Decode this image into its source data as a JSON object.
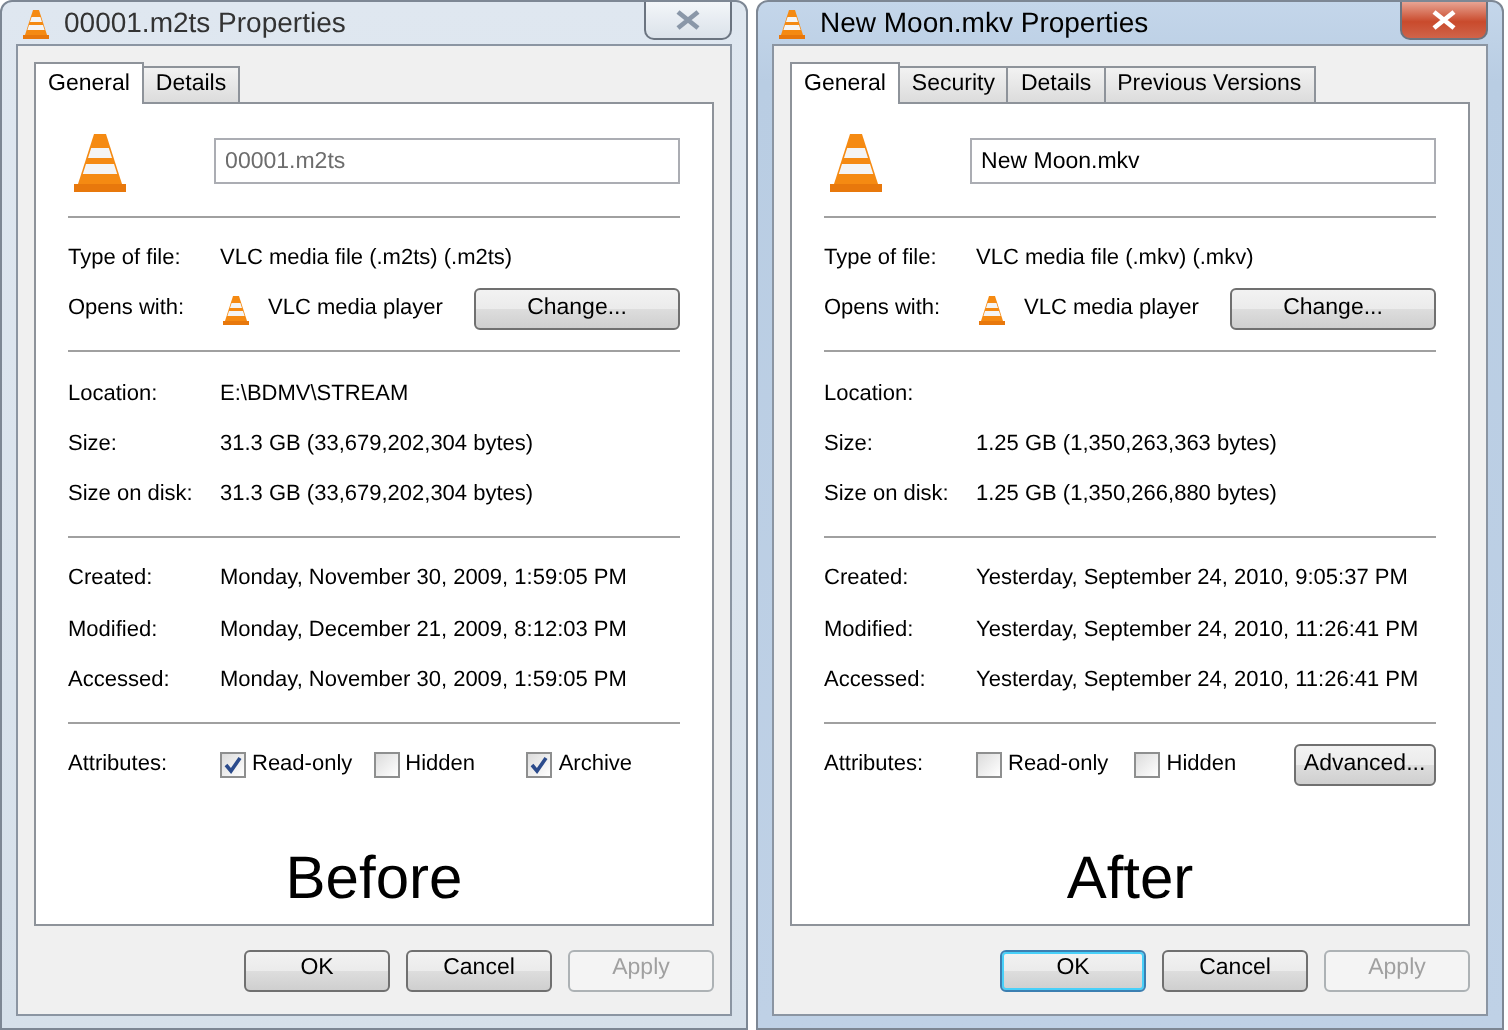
{
  "dialogs": [
    {
      "title": "00001.m2ts Properties",
      "active": false,
      "tabs": [
        {
          "label": "General",
          "selected": true
        },
        {
          "label": "Details",
          "selected": false
        }
      ],
      "file_name": {
        "value": "00001.m2ts",
        "disabled": true
      },
      "type_row": {
        "label": "Type of file:",
        "value": "VLC media file (.m2ts) (.m2ts)"
      },
      "opens_with": {
        "label": "Opens with:",
        "value": "VLC media player",
        "button": "Change..."
      },
      "sections": [
        [
          {
            "label": "Location:",
            "value": "E:\\BDMV\\STREAM"
          },
          {
            "label": "Size:",
            "value": "31.3 GB (33,679,202,304 bytes)"
          },
          {
            "label": "Size on disk:",
            "value": "31.3 GB (33,679,202,304 bytes)"
          }
        ],
        [
          {
            "label": "Created:",
            "value": "Monday, November 30, 2009, 1:59:05 PM"
          },
          {
            "label": "Modified:",
            "value": "Monday, December 21, 2009, 8:12:03 PM"
          },
          {
            "label": "Accessed:",
            "value": "Monday, November 30, 2009, 1:59:05 PM"
          }
        ]
      ],
      "attributes": {
        "label": "Attributes:",
        "checkboxes": [
          {
            "label": "Read-only",
            "checked": true
          },
          {
            "label": "Hidden",
            "checked": false
          },
          {
            "label": "Archive",
            "checked": true
          }
        ]
      },
      "caption": "Before",
      "buttons": [
        {
          "label": "OK",
          "default": false,
          "disabled": false
        },
        {
          "label": "Cancel",
          "default": false,
          "disabled": false
        },
        {
          "label": "Apply",
          "default": false,
          "disabled": true
        }
      ]
    },
    {
      "title": "New Moon.mkv Properties",
      "active": true,
      "tabs": [
        {
          "label": "General",
          "selected": true
        },
        {
          "label": "Security",
          "selected": false
        },
        {
          "label": "Details",
          "selected": false
        },
        {
          "label": "Previous Versions",
          "selected": false
        }
      ],
      "file_name": {
        "value": "New Moon.mkv",
        "disabled": false
      },
      "type_row": {
        "label": "Type of file:",
        "value": "VLC media file (.mkv) (.mkv)"
      },
      "opens_with": {
        "label": "Opens with:",
        "value": "VLC media player",
        "button": "Change..."
      },
      "sections": [
        [
          {
            "label": "Location:"
          },
          {
            "label": "Size:",
            "value": "1.25 GB (1,350,263,363 bytes)"
          },
          {
            "label": "Size on disk:",
            "value": "1.25 GB (1,350,266,880 bytes)"
          }
        ],
        [
          {
            "label": "Created:",
            "value": "Yesterday, September 24, 2010, 9:05:37 PM"
          },
          {
            "label": "Modified:",
            "value": "Yesterday, September 24, 2010, 11:26:41 PM"
          },
          {
            "label": "Accessed:",
            "value": "Yesterday, September 24, 2010, 11:26:41 PM"
          }
        ]
      ],
      "attributes": {
        "label": "Attributes:",
        "checkboxes": [
          {
            "label": "Read-only",
            "checked": false
          },
          {
            "label": "Hidden",
            "checked": false
          }
        ],
        "button": "Advanced..."
      },
      "caption": "After",
      "buttons": [
        {
          "label": "OK",
          "default": true,
          "disabled": false
        },
        {
          "label": "Cancel",
          "default": false,
          "disabled": false
        },
        {
          "label": "Apply",
          "default": false,
          "disabled": true
        }
      ]
    }
  ]
}
